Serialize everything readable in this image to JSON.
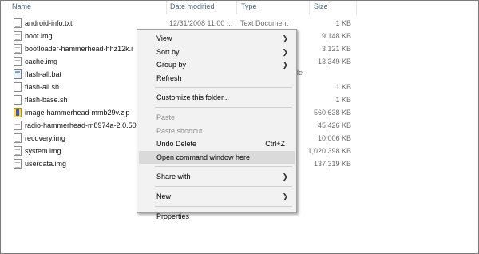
{
  "columns": {
    "name": "Name",
    "date": "Date modified",
    "type": "Type",
    "size": "Size"
  },
  "files": [
    {
      "name": "android-info.txt",
      "date": "12/31/2008 11:00 ...",
      "type": "Text Document",
      "size": "1 KB",
      "icon": "text-file-icon"
    },
    {
      "name": "boot.img",
      "date": "",
      "type": "",
      "size": "9,148 KB",
      "icon": "image-file-icon"
    },
    {
      "name": "bootloader-hammerhead-hhz12k.i",
      "date": "",
      "type": "",
      "size": "3,121 KB",
      "icon": "image-file-icon"
    },
    {
      "name": "cache.img",
      "date": "",
      "type": "",
      "size": "13,349 KB",
      "icon": "image-file-icon"
    },
    {
      "name": "flash-all.bat",
      "date": "",
      "type": "",
      "size": "",
      "icon": "batch-file-icon"
    },
    {
      "name": "flash-all.sh",
      "date": "",
      "type": "",
      "size": "1 KB",
      "icon": "shell-file-icon"
    },
    {
      "name": "flash-base.sh",
      "date": "",
      "type": "",
      "size": "1 KB",
      "icon": "shell-file-icon"
    },
    {
      "name": "image-hammerhead-mmb29v.zip",
      "date": "",
      "type": "",
      "size": "560,638 KB",
      "icon": "zip-file-icon"
    },
    {
      "name": "radio-hammerhead-m8974a-2.0.50",
      "date": "",
      "type": "",
      "size": "45,426 KB",
      "icon": "image-file-icon"
    },
    {
      "name": "recovery.img",
      "date": "",
      "type": "",
      "size": "10,006 KB",
      "icon": "image-file-icon"
    },
    {
      "name": "system.img",
      "date": "",
      "type": "",
      "size": "1,020,398 KB",
      "icon": "image-file-icon"
    },
    {
      "name": "userdata.img",
      "date": "",
      "type": "",
      "size": "137,319 KB",
      "icon": "image-file-icon"
    }
  ],
  "partial_type_text": "le",
  "context_menu": {
    "items": [
      {
        "label": "View",
        "submenu": true,
        "shortcut": "",
        "disabled": false,
        "highlighted": false
      },
      {
        "label": "Sort by",
        "submenu": true,
        "shortcut": "",
        "disabled": false,
        "highlighted": false
      },
      {
        "label": "Group by",
        "submenu": true,
        "shortcut": "",
        "disabled": false,
        "highlighted": false
      },
      {
        "label": "Refresh",
        "submenu": false,
        "shortcut": "",
        "disabled": false,
        "highlighted": false
      },
      {
        "separator": true
      },
      {
        "label": "Customize this folder...",
        "submenu": false,
        "shortcut": "",
        "disabled": false,
        "highlighted": false
      },
      {
        "separator": true
      },
      {
        "label": "Paste",
        "submenu": false,
        "shortcut": "",
        "disabled": true,
        "highlighted": false
      },
      {
        "label": "Paste shortcut",
        "submenu": false,
        "shortcut": "",
        "disabled": true,
        "highlighted": false
      },
      {
        "label": "Undo Delete",
        "submenu": false,
        "shortcut": "Ctrl+Z",
        "disabled": false,
        "highlighted": false
      },
      {
        "label": "Open command window here",
        "submenu": false,
        "shortcut": "",
        "disabled": false,
        "highlighted": true
      },
      {
        "separator": true
      },
      {
        "label": "Share with",
        "submenu": true,
        "shortcut": "",
        "disabled": false,
        "highlighted": false
      },
      {
        "separator": true
      },
      {
        "label": "New",
        "submenu": true,
        "shortcut": "",
        "disabled": false,
        "highlighted": false
      },
      {
        "separator": true
      },
      {
        "label": "Properties",
        "submenu": false,
        "shortcut": "",
        "disabled": false,
        "highlighted": false
      }
    ]
  },
  "colors": {
    "highlight": "#dadada",
    "menu_bg": "#f2f2f2",
    "header_text": "#4c607a"
  }
}
